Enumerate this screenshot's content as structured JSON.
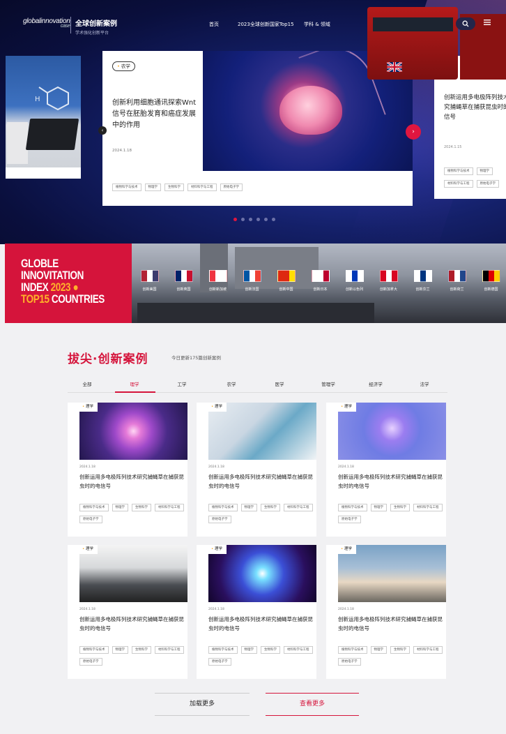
{
  "header": {
    "logo_en": "globalinnovation",
    "logo_en_sub": "case",
    "logo_cn": "全球创新案例",
    "logo_cn_sub": "学术强化创新平台",
    "nav": [
      "首页",
      "2023全球创新国家Top15",
      "学科 & 领域"
    ],
    "icons": {
      "search": "search-icon",
      "menu": "menu-icon"
    }
  },
  "carousel": {
    "left_card_icon": "lab-photo",
    "main": {
      "tag": "农学",
      "title": "创新利用细胞通讯探索Wnt信号在胚胎发育和癌症发展中的作用",
      "date": "2024.1.18",
      "chips": [
        "植物科学与技术",
        "物理学",
        "生物科学",
        "材料科学与工程",
        "原始电子学"
      ]
    },
    "right": {
      "title": "创新运用多电极阵列技术研究捕蝇草在捕获昆虫时的电信号",
      "date": "2024.1.15",
      "chips": [
        "植物科学与技术",
        "物理学",
        "材料科学与工程",
        "原始电子学"
      ]
    },
    "active_dot": 0,
    "dot_count": 6
  },
  "banner": {
    "line1": "GLOBLE",
    "line2": "INNOVITATION",
    "line3a": "INDEX",
    "line3b": "2023",
    "line4a": "TOP15",
    "line4b": "COUNTRIES",
    "countries": [
      {
        "name": "创新美国",
        "colors": [
          "#b22234",
          "#ffffff",
          "#3c3b6e"
        ]
      },
      {
        "name": "创新英国",
        "colors": [
          "#012169",
          "#ffffff",
          "#c8102e"
        ]
      },
      {
        "name": "创新新加坡",
        "colors": [
          "#ef3340",
          "#ffffff",
          "#ffffff"
        ]
      },
      {
        "name": "创新法国",
        "colors": [
          "#0055a4",
          "#ffffff",
          "#ef4135"
        ]
      },
      {
        "name": "创新中国",
        "colors": [
          "#de2910",
          "#de2910",
          "#ffde00"
        ]
      },
      {
        "name": "创新日本",
        "colors": [
          "#ffffff",
          "#ffffff",
          "#bc002d"
        ]
      },
      {
        "name": "创新以色列",
        "colors": [
          "#ffffff",
          "#0038b8",
          "#ffffff"
        ]
      },
      {
        "name": "创新加拿大",
        "colors": [
          "#d80621",
          "#ffffff",
          "#d80621"
        ]
      },
      {
        "name": "创新芬兰",
        "colors": [
          "#ffffff",
          "#003580",
          "#ffffff"
        ]
      },
      {
        "name": "创新荷兰",
        "colors": [
          "#ae1c28",
          "#ffffff",
          "#21468b"
        ]
      },
      {
        "name": "创新德国",
        "colors": [
          "#000000",
          "#dd0000",
          "#ffce00"
        ]
      }
    ]
  },
  "section": {
    "title": "拔尖·创新案例",
    "subtitle": "今日更新175篇创新案例",
    "tabs": [
      "全部",
      "理学",
      "工学",
      "农学",
      "医学",
      "管理学",
      "经济学",
      "法学"
    ],
    "active_tab": 1
  },
  "cards": [
    {
      "label": "理学",
      "image": "plasma-ball",
      "date": "2024.1.18",
      "title": "创新运用多电极阵列技术研究捕蝇草在捕获昆虫时的电信号",
      "chips": [
        "植物科学与技术",
        "物理学",
        "生物科学",
        "材料科学与工程",
        "原始电子学"
      ]
    },
    {
      "label": "理学",
      "image": "lab-test-tubes",
      "date": "2024.1.18",
      "title": "创新运用多电极阵列技术研究捕蝇草在捕获昆虫时的电信号",
      "chips": [
        "植物科学与技术",
        "物理学",
        "生物科学",
        "材料科学与工程",
        "原始电子学"
      ]
    },
    {
      "label": "理学",
      "image": "glowing-brain",
      "date": "2024.1.18",
      "title": "创新运用多电极阵列技术研究捕蝇草在捕获昆虫时的电信号",
      "chips": [
        "植物科学与技术",
        "物理学",
        "生物科学",
        "材料科学与工程",
        "原始电子学"
      ]
    },
    {
      "label": "理学",
      "image": "microscopes",
      "date": "2024.1.18",
      "title": "创新运用多电极阵列技术研究捕蝇草在捕获昆虫时的电信号",
      "chips": [
        "植物科学与技术",
        "物理学",
        "生物科学",
        "材料科学与工程",
        "原始电子学"
      ]
    },
    {
      "label": "理学",
      "image": "neon-structure",
      "date": "2024.1.18",
      "title": "创新运用多电极阵列技术研究捕蝇草在捕获昆虫时的电信号",
      "chips": [
        "植物科学与技术",
        "物理学",
        "生物科学",
        "材料科学与工程",
        "原始电子学"
      ]
    },
    {
      "label": "理学",
      "image": "rocket-launch",
      "date": "2024.1.18",
      "title": "创新运用多电极阵列技术研究捕蝇草在捕获昆虫时的电信号",
      "chips": [
        "植物科学与技术",
        "物理学",
        "生物科学",
        "材料科学与工程",
        "原始电子学"
      ]
    }
  ],
  "buttons": {
    "load_more": "加载更多",
    "view_more": "查看更多"
  },
  "colors": {
    "accent": "#d5143b",
    "hero_bg": "#0a0f3d",
    "banner_yellow": "#ffb12a",
    "label_dot": "#f3a41a"
  }
}
